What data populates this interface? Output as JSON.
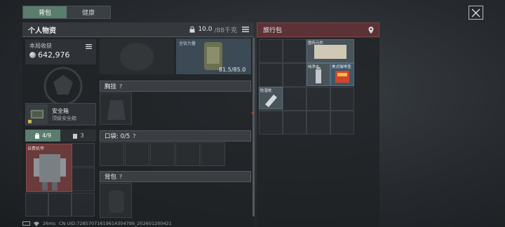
{
  "top_tabs": [
    {
      "label": "背包",
      "active": true
    },
    {
      "label": "健康",
      "active": false
    }
  ],
  "left_panel": {
    "title": "个人物资",
    "weight": "10.0",
    "weight_max": "/88千克",
    "earnings_label": "本局收获",
    "earnings_value": "642,976",
    "safe_box": {
      "name": "安全箱",
      "sub": "顶级安全箱"
    },
    "subtabs": [
      {
        "label": "4/9",
        "icon": "backpack-icon"
      },
      {
        "label": "3",
        "icon": "box-icon"
      }
    ],
    "armor_label": "自费机甲"
  },
  "center": {
    "armor_name": "全钛力量",
    "armor_durability": "81.5/85.0",
    "chest_rig": "胸挂",
    "pockets": "口袋: 0/5",
    "backpack": "背包",
    "help": "?"
  },
  "right_panel": {
    "title": "旅行包",
    "items": [
      {
        "label": "图传元件"
      },
      {
        "label": "纯净水"
      },
      {
        "label": "美式咖啡壶"
      },
      {
        "label": "防湿枕"
      }
    ]
  },
  "status_bar": {
    "ping": "26ms",
    "uid": "CN UID:7285707161961430479​9_202601200421"
  },
  "colors": {
    "accent_tab": "#5a7d6e",
    "travel_bag_header": "#5c3236",
    "armor_cell": "#6b3a3a"
  }
}
